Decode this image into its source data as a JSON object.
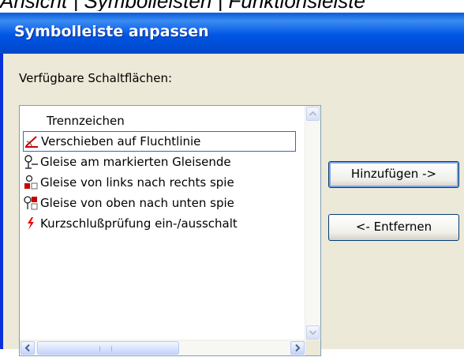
{
  "caption": "Ansicht | Symbolleisten | Funktionsleiste",
  "dialog": {
    "title": "Symbolleiste anpassen",
    "available_label": "Verfügbare Schaltflächen:",
    "items": [
      {
        "label": "Trennzeichen",
        "icon": "none"
      },
      {
        "label": "Verschieben auf Fluchtlinie",
        "icon": "move-to-line-icon",
        "selected": true
      },
      {
        "label": "Gleise am markierten Gleisende",
        "icon": "track-end-icon"
      },
      {
        "label": "Gleise von links nach rechts spie",
        "icon": "mirror-horizontal-icon"
      },
      {
        "label": "Gleise von oben nach unten spie",
        "icon": "mirror-vertical-icon"
      },
      {
        "label": "Kurzschlußprüfung ein-/ausschalt",
        "icon": "short-circuit-icon"
      }
    ],
    "add_button": "Hinzufügen ->",
    "remove_button": "<- Entfernen"
  },
  "colors": {
    "titlebar": "#0055E5",
    "dialog_bg": "#ECE9D8",
    "list_border": "#7F9DB9",
    "selection": "#316AC5"
  }
}
